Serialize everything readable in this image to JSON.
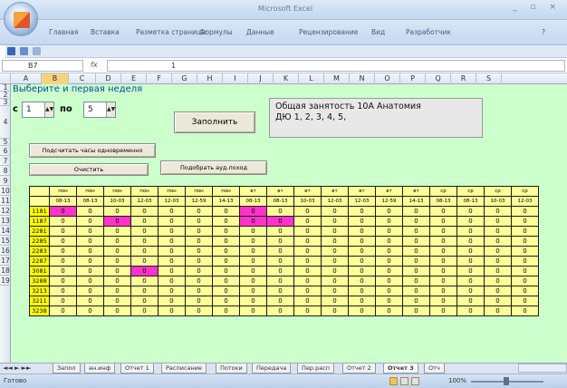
{
  "window": {
    "title": "Microsoft Excel",
    "controls": "_ ▫ ×"
  },
  "ribbon": {
    "tabs": [
      "Главная",
      "Вставка",
      "Разметка страницы",
      "Формулы",
      "Данные",
      "Рецензирование",
      "Вид",
      "Разработчик"
    ],
    "help": "?"
  },
  "formula_bar": {
    "name_box": "B7",
    "fx_label": "fx",
    "value": "1"
  },
  "columns": [
    "A",
    "B",
    "C",
    "D",
    "E",
    "F",
    "G",
    "H",
    "I",
    "J",
    "K",
    "L",
    "M",
    "N",
    "O",
    "P",
    "Q",
    "R",
    "S"
  ],
  "selected_column": "B",
  "rows": [
    "1",
    "2",
    "3",
    "4",
    "5",
    "6",
    "7",
    "8",
    "9",
    "10",
    "11",
    "12",
    "13",
    "14",
    "15",
    "16",
    "17",
    "18",
    "19"
  ],
  "form": {
    "heading": "Выберите и первая неделя",
    "label_c": "с",
    "label_po": "по",
    "spin_from": "1",
    "spin_to": "5",
    "fill_button": "Заполнить",
    "info_line1": "Общая занятость 10А Анатомия",
    "info_line2": "ДЮ  1,  2,  3,  4,  5,",
    "hours_button": "Подсчитать часы одновременно",
    "clear_button": "Очистить",
    "pick_button": "Подобрать ауд.поход"
  },
  "table": {
    "day_headers": [
      "пон",
      "пон",
      "пон",
      "пон",
      "пон",
      "пон",
      "пон",
      "вт",
      "вт",
      "вт",
      "вт",
      "вт",
      "вт",
      "вт",
      "ср",
      "ср",
      "ср",
      "ср"
    ],
    "time_headers": [
      "08-13",
      "08-13",
      "10-03",
      "12-03",
      "12-03",
      "12-59",
      "14-13",
      "08-13",
      "08-13",
      "10-03",
      "12-03",
      "12-03",
      "12-59",
      "14-13",
      "08-13",
      "08-13",
      "10-03",
      "12-03"
    ],
    "rows": [
      {
        "id": "1181",
        "cells": [
          "0",
          "0",
          "0",
          "0",
          "0",
          "0",
          "0",
          "0",
          "0",
          "0",
          "0",
          "0",
          "0",
          "0",
          "0",
          "0",
          "0",
          "0"
        ],
        "hl": [
          0,
          7
        ]
      },
      {
        "id": "1187",
        "cells": [
          "0",
          "0",
          "0",
          "0",
          "0",
          "0",
          "0",
          "0",
          "0",
          "0",
          "0",
          "0",
          "0",
          "0",
          "0",
          "0",
          "0",
          "0"
        ],
        "hl": [
          2,
          7,
          8
        ]
      },
      {
        "id": "2281",
        "cells": [
          "0",
          "0",
          "0",
          "0",
          "0",
          "0",
          "0",
          "0",
          "0",
          "0",
          "0",
          "0",
          "0",
          "0",
          "0",
          "0",
          "0",
          "0"
        ],
        "hl": []
      },
      {
        "id": "2285",
        "cells": [
          "0",
          "0",
          "0",
          "0",
          "0",
          "0",
          "0",
          "0",
          "0",
          "0",
          "0",
          "0",
          "0",
          "0",
          "0",
          "0",
          "0",
          "0"
        ],
        "hl": []
      },
      {
        "id": "2283",
        "cells": [
          "0",
          "0",
          "0",
          "0",
          "0",
          "0",
          "0",
          "0",
          "0",
          "0",
          "0",
          "0",
          "0",
          "0",
          "0",
          "0",
          "0",
          "0"
        ],
        "hl": []
      },
      {
        "id": "2287",
        "cells": [
          "0",
          "0",
          "0",
          "0",
          "0",
          "0",
          "0",
          "0",
          "0",
          "0",
          "0",
          "0",
          "0",
          "0",
          "0",
          "0",
          "0",
          "0"
        ],
        "hl": []
      },
      {
        "id": "3081",
        "cells": [
          "0",
          "0",
          "0",
          "0",
          "0",
          "0",
          "0",
          "0",
          "0",
          "0",
          "0",
          "0",
          "0",
          "0",
          "0",
          "0",
          "0",
          "0"
        ],
        "hl": [
          3
        ]
      },
      {
        "id": "3288",
        "cells": [
          "0",
          "0",
          "0",
          "0",
          "0",
          "0",
          "0",
          "0",
          "0",
          "0",
          "0",
          "0",
          "0",
          "0",
          "0",
          "0",
          "0",
          "0"
        ],
        "hl": []
      },
      {
        "id": "3213",
        "cells": [
          "0",
          "0",
          "0",
          "0",
          "0",
          "0",
          "0",
          "0",
          "0",
          "0",
          "0",
          "0",
          "0",
          "0",
          "0",
          "0",
          "0",
          "0"
        ],
        "hl": []
      },
      {
        "id": "3211",
        "cells": [
          "0",
          "0",
          "0",
          "0",
          "0",
          "0",
          "0",
          "0",
          "0",
          "0",
          "0",
          "0",
          "0",
          "0",
          "0",
          "0",
          "0",
          "0"
        ],
        "hl": []
      },
      {
        "id": "3238",
        "cells": [
          "0",
          "0",
          "0",
          "0",
          "0",
          "0",
          "0",
          "0",
          "0",
          "0",
          "0",
          "0",
          "0",
          "0",
          "0",
          "0",
          "0",
          "0"
        ],
        "hl": []
      }
    ]
  },
  "sheet_tabs": [
    "Запол",
    "ан.инф",
    "Отчет 1",
    "Расписание",
    "Потоки",
    "Передача",
    "Пер.расп",
    "Отчет 2",
    "Отчет 3",
    "Отч"
  ],
  "active_tab": "Отчет 3",
  "status": {
    "ready": "Готово",
    "zoom": "100%"
  },
  "colors": {
    "sheet_bg": "#ccffcc",
    "id_cell": "#ffff00",
    "data_cell": "#ffff99",
    "highlight": "#ff33cc",
    "selected_col": "#f7d27c"
  }
}
